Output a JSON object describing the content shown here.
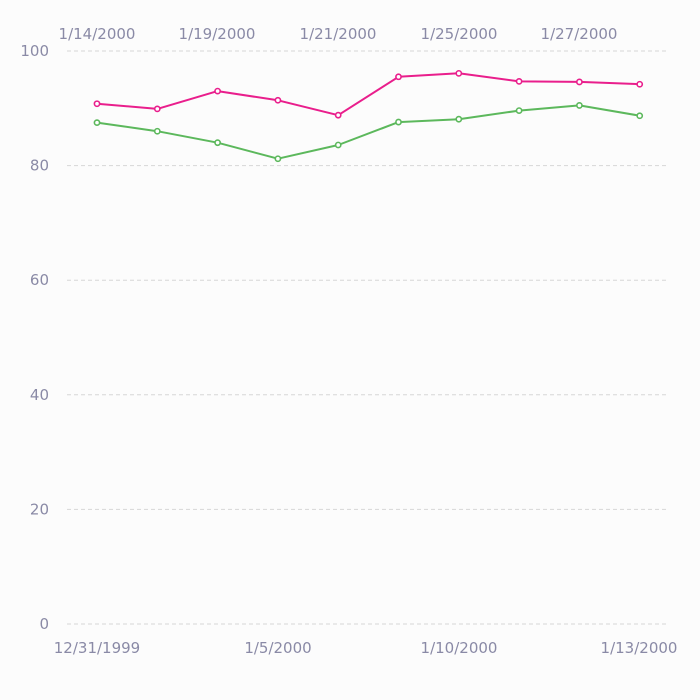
{
  "chart_data": {
    "type": "line",
    "x_bottom_labels": [
      "12/31/1999",
      "1/5/2000",
      "1/10/2000",
      "1/13/2000"
    ],
    "x_top_labels": [
      "1/14/2000",
      "1/19/2000",
      "1/21/2000",
      "1/25/2000",
      "1/27/2000"
    ],
    "y_ticks": [
      0,
      20,
      40,
      60,
      80,
      100
    ],
    "ylim": [
      0,
      100
    ],
    "grid": true,
    "legend": "none",
    "series": [
      {
        "color": "#e91e8c",
        "values": [
          90.8,
          89.9,
          93.0,
          91.4,
          88.8,
          95.5,
          96.1,
          94.7,
          94.6,
          94.2
        ]
      },
      {
        "color": "#5cb85c",
        "values": [
          87.5,
          86.0,
          84.0,
          81.2,
          83.6,
          87.6,
          88.1,
          89.6,
          90.5,
          88.7
        ]
      }
    ]
  }
}
